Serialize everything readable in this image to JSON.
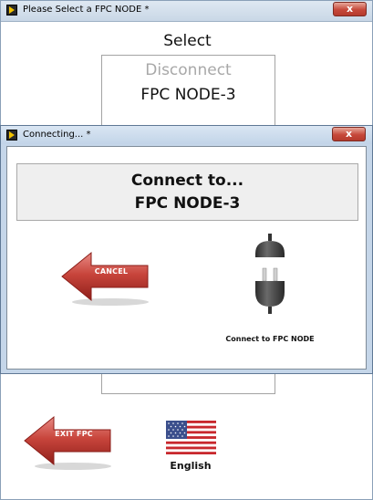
{
  "main_window": {
    "title": "Please Select a FPC NODE *",
    "close_label": "x",
    "select_label": "Select",
    "list_items": [
      "Disconnect",
      "FPC NODE-3"
    ],
    "exit_button_label": "EXIT FPC",
    "language_label": "English"
  },
  "dialog": {
    "title": "Connecting... *",
    "close_label": "x",
    "message_line1": "Connect to...",
    "message_line2": "FPC NODE-3",
    "cancel_label": "CANCEL",
    "connect_label": "Connect to FPC NODE"
  },
  "icons": {
    "window_icon": "labview-run-icon",
    "exit_icon": "red-left-arrow-icon",
    "cancel_icon": "red-left-arrow-icon",
    "plug_icon": "plug-connector-icon",
    "flag_icon": "us-flag-icon"
  },
  "colors": {
    "arrow_red": "#b5342d",
    "titlebar_blue": "#c5d6e9",
    "close_red": "#c6483a"
  }
}
